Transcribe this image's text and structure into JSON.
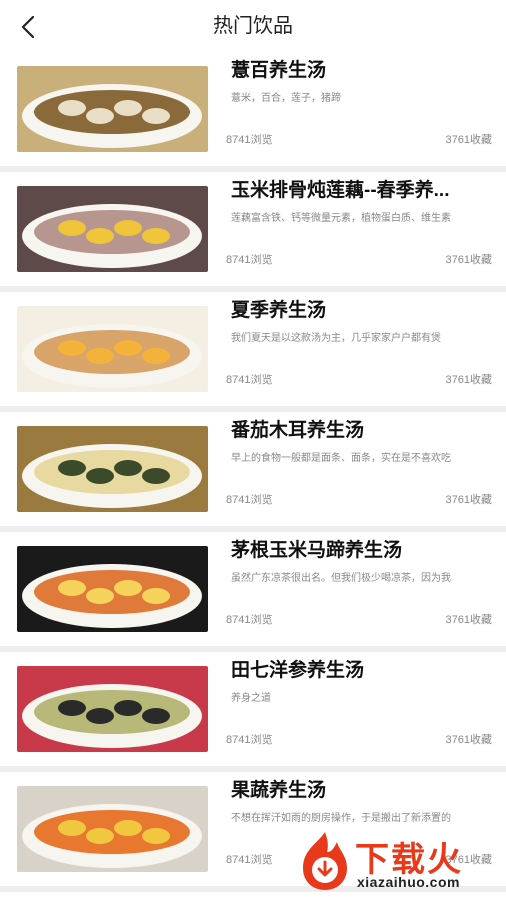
{
  "header": {
    "title": "热门饮品",
    "back_icon": "chevron-left-icon"
  },
  "items": [
    {
      "title": "薏百养生汤",
      "desc": "薏米，百合，莲子，猪蹄",
      "views": "8741浏览",
      "favs": "3761收藏",
      "palette": [
        "#c9b07a",
        "#e9dfc6",
        "#8a6a3a"
      ]
    },
    {
      "title": "玉米排骨炖莲藕--春季养...",
      "desc": "莲藕富含铁、钙等微量元素，植物蛋白质、维生素",
      "views": "8741浏览",
      "favs": "3761收藏",
      "palette": [
        "#5e4a48",
        "#f0c53a",
        "#b89690"
      ]
    },
    {
      "title": "夏季养生汤",
      "desc": "我们夏天是以这款汤为主，几乎家家户户都有煲",
      "views": "8741浏览",
      "favs": "3761收藏",
      "palette": [
        "#f4efe2",
        "#f3b33a",
        "#d9a46a"
      ]
    },
    {
      "title": "番茄木耳养生汤",
      "desc": "早上的食物一般都是面条、面条，实在是不喜欢吃",
      "views": "8741浏览",
      "favs": "3761收藏",
      "palette": [
        "#9a7a3e",
        "#3a4a2a",
        "#e8d9a0"
      ]
    },
    {
      "title": "茅根玉米马蹄养生汤",
      "desc": "虽然广东凉茶很出名。但我们极少喝凉茶，因为我",
      "views": "8741浏览",
      "favs": "3761收藏",
      "palette": [
        "#1a1a1a",
        "#f5d35a",
        "#e07a3a"
      ]
    },
    {
      "title": "田七洋参养生汤",
      "desc": "养身之道",
      "views": "8741浏览",
      "favs": "3761收藏",
      "palette": [
        "#c83a4a",
        "#2a2a2a",
        "#b8b878"
      ]
    },
    {
      "title": "果蔬养生汤",
      "desc": "不想在挥汗如雨的厨房操作，于是搬出了新添置的",
      "views": "8741浏览",
      "favs": "3761收藏",
      "palette": [
        "#d8d2c8",
        "#f0c840",
        "#e87830"
      ]
    }
  ],
  "watermark": {
    "text": "下载火",
    "url": "xiazaihuo.com",
    "icon": "flame-logo-icon"
  }
}
